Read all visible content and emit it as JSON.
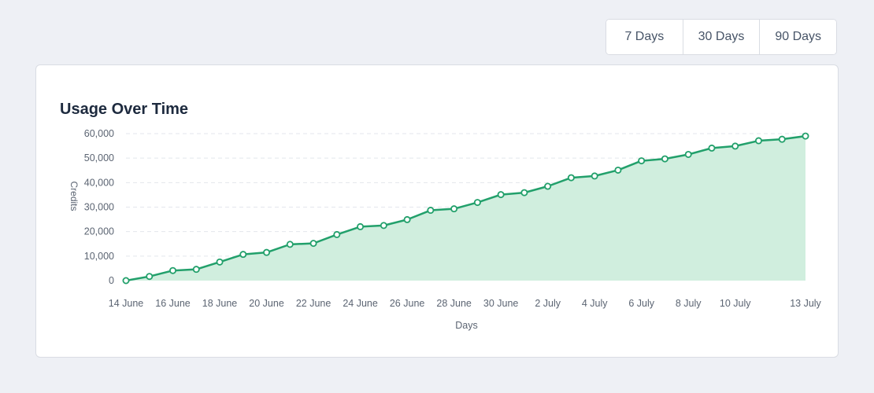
{
  "range_buttons": [
    "7 Days",
    "30 Days",
    "90 Days"
  ],
  "card": {
    "title": "Usage Over Time"
  },
  "colors": {
    "line": "#22a06b",
    "fill": "#d0eede",
    "grid": "#e3e6ec",
    "text": "#5b6472"
  },
  "chart_data": {
    "type": "area",
    "title": "Usage Over Time",
    "xlabel": "Days",
    "ylabel": "Credits",
    "ylim": [
      0,
      60000
    ],
    "y_ticks": [
      0,
      10000,
      20000,
      30000,
      40000,
      50000,
      60000
    ],
    "y_tick_labels": [
      "0",
      "10,000",
      "20,000",
      "30,000",
      "40,000",
      "50,000",
      "60,000"
    ],
    "x_tick_labels": [
      "14 June",
      "16 June",
      "18 June",
      "20 June",
      "22 June",
      "24 June",
      "26 June",
      "28 June",
      "30 June",
      "2 July",
      "4 July",
      "6 July",
      "8 July",
      "10 July",
      "13 July"
    ],
    "grid": "horizontal dashed",
    "series": [
      {
        "x": [
          "14 June",
          "15 June",
          "16 June",
          "17 June",
          "18 June",
          "19 June",
          "20 June",
          "21 June",
          "22 June",
          "23 June",
          "24 June",
          "25 June",
          "26 June",
          "27 June",
          "28 June",
          "29 June",
          "30 June",
          "1 July",
          "2 July",
          "3 July",
          "4 July",
          "5 July",
          "6 July",
          "7 July",
          "8 July",
          "9 July",
          "10 July",
          "11 July",
          "12 July",
          "13 July"
        ],
        "values": [
          0,
          1700,
          4100,
          4600,
          7600,
          10700,
          11500,
          14800,
          15200,
          18800,
          22000,
          22500,
          24900,
          28700,
          29300,
          31900,
          35100,
          35900,
          38500,
          42000,
          42700,
          45100,
          48900,
          49700,
          51500,
          54100,
          54900,
          57100,
          57700,
          59000
        ]
      }
    ]
  }
}
